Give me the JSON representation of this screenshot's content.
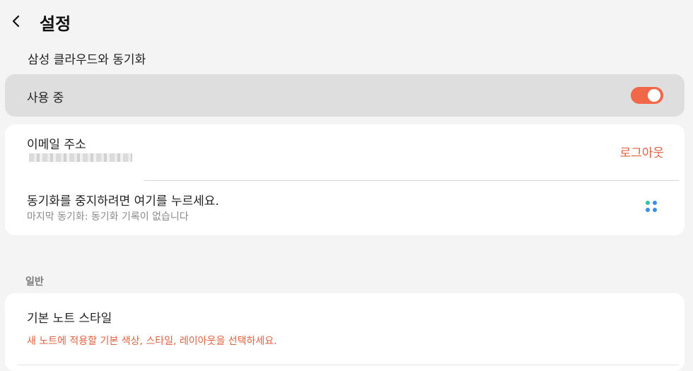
{
  "header": {
    "title": "설정"
  },
  "cloud_section": {
    "title": "삼성 클라우드와 동기화"
  },
  "master_toggle": {
    "label": "사용 중",
    "on": true,
    "accent": "#f06848"
  },
  "account": {
    "email_label": "이메일 주소",
    "logout_label": "로그아웃"
  },
  "sync": {
    "stop_label": "동기화를 중지하려면 여기를 누르세요.",
    "status": "마지막 동기화: 동기화 기록이 없습니다",
    "icon": "sync-dots-icon",
    "icon_colors": [
      "#2ec4a6",
      "#3a8bf0",
      "#3a8bf0",
      "#3a8bf0"
    ]
  },
  "general_section": {
    "title": "일반"
  },
  "note_style": {
    "label": "기본 노트 스타일",
    "description": "새 노트에 적용할 기본 색상, 스타일, 레이아웃을 선택하세요."
  },
  "colors": {
    "accent": "#e0623f",
    "toggle": "#f06848",
    "background": "#f4f4f4"
  }
}
